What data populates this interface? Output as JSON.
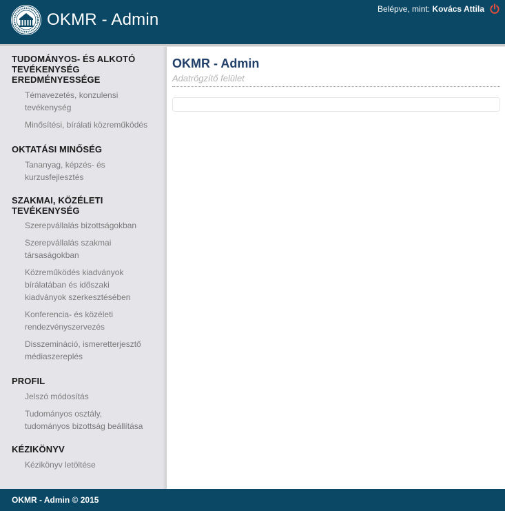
{
  "header": {
    "title": "OKMR - Admin",
    "user_prefix": "Belépve, mint:",
    "user_name": "Kovács Attila",
    "logo_icon": "university-seal-icon",
    "logout_icon": "power-icon",
    "colors": {
      "header_bg": "#0b4866",
      "logout": "#e84e3c"
    }
  },
  "sidebar": {
    "sections": [
      {
        "title_lines": [
          "TUDOMÁNYOS- ÉS ALKOTÓ",
          "TEVÉKENYSÉG",
          "EREDMÉNYESSÉGE"
        ],
        "items": [
          {
            "lines": [
              "Témavezetés, konzulensi",
              "tevékenység"
            ]
          },
          {
            "lines": [
              "Minősítési, bírálati közreműködés"
            ]
          }
        ]
      },
      {
        "title_lines": [
          "OKTATÁSI MINŐSÉG"
        ],
        "items": [
          {
            "lines": [
              "Tananyag, képzés- és",
              "kurzusfejlesztés"
            ]
          }
        ]
      },
      {
        "title_lines": [
          "SZAKMAI, KÖZÉLETI",
          "TEVÉKENYSÉG"
        ],
        "items": [
          {
            "lines": [
              "Szerepvállalás bizottságokban"
            ]
          },
          {
            "lines": [
              "Szerepvállalás szakmai",
              "társaságokban"
            ]
          },
          {
            "lines": [
              "Közreműködés kiadványok",
              "bírálatában és időszaki",
              "kiadványok szerkesztésében"
            ]
          },
          {
            "lines": [
              "Konferencia- és közéleti",
              "rendezvényszervezés"
            ]
          },
          {
            "lines": [
              "Disszemináció, ismeretterjesztő",
              "médiaszereplés"
            ]
          }
        ]
      },
      {
        "title_lines": [
          "PROFIL"
        ],
        "items": [
          {
            "lines": [
              "Jelszó módosítás"
            ]
          },
          {
            "lines": [
              "Tudományos osztály,",
              "tudományos bizottság beállítása"
            ]
          }
        ]
      },
      {
        "title_lines": [
          "KÉZIKÖNYV"
        ],
        "items": [
          {
            "lines": [
              "Kézikönyv letöltése"
            ]
          }
        ]
      }
    ]
  },
  "main": {
    "title": "OKMR - Admin",
    "subtitle": "Adatrögzítő felület"
  },
  "footer": {
    "text": "OKMR - Admin © 2015"
  }
}
